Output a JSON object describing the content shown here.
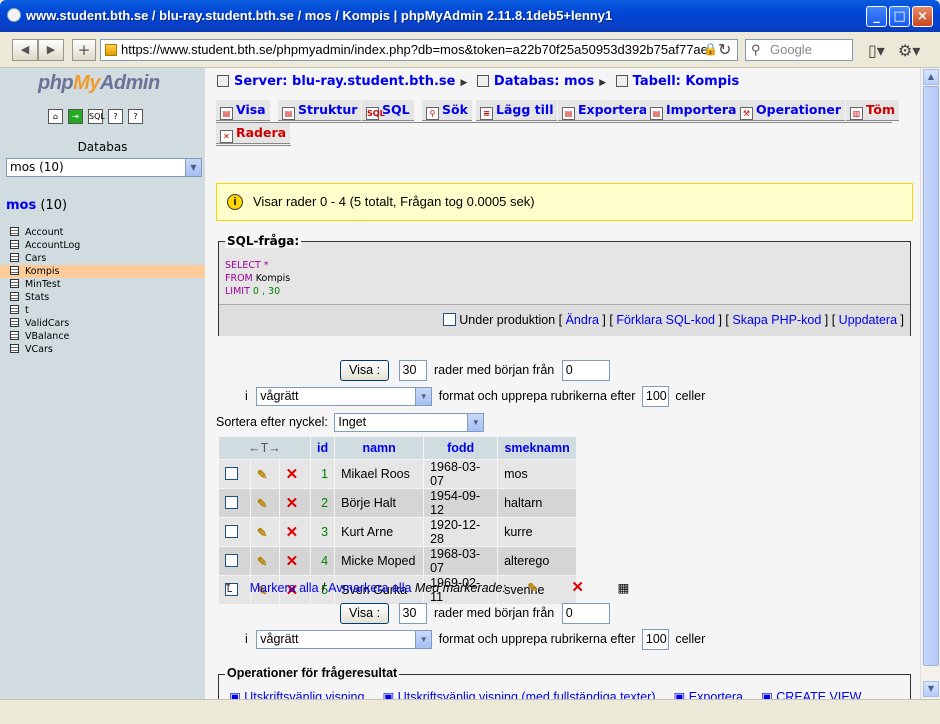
{
  "window": {
    "title": "www.student.bth.se / blu-ray.student.bth.se / mos / Kompis | phpMyAdmin 2.11.8.1deb5+lenny1"
  },
  "browser": {
    "url": "https://www.student.bth.se/phpmyadmin/index.php?db=mos&token=a22b70f25a50953d392b75af77ae",
    "search_placeholder": "Google"
  },
  "sidebar": {
    "logo": {
      "php": "php",
      "my": "My",
      "admin": "Admin"
    },
    "db_label": "Databas",
    "db_select": "mos (10)",
    "db_name": "mos",
    "db_count": "(10)",
    "tables": [
      "Account",
      "AccountLog",
      "Cars",
      "Kompis",
      "MinTest",
      "Stats",
      "t",
      "ValidCars",
      "VBalance",
      "VCars"
    ],
    "active_table": "Kompis"
  },
  "breadcrumb": {
    "server": "Server: blu-ray.student.bth.se",
    "database": "Databas: mos",
    "table": "Tabell: Kompis"
  },
  "tabs": [
    "Visa",
    "Struktur",
    "SQL",
    "Sök",
    "Lägg till",
    "Exportera",
    "Importera",
    "Operationer",
    "Töm",
    "Radera"
  ],
  "notice": "Visar rader 0 - 4 (5 totalt, Frågan tog 0.0005 sek)",
  "sql": {
    "legend": "SQL-fråga:",
    "select": "SELECT",
    "star": " *",
    "from": "FROM",
    "table": " Kompis",
    "limit": "LIMIT",
    "limit_vals": " 0 , 30"
  },
  "sql_links": {
    "production": "Under produktion",
    "edit": "Ändra",
    "explain": "Förklara SQL-kod",
    "php": "Skapa PHP-kod",
    "refresh": "Uppdatera"
  },
  "nav_top": {
    "show_button": "Visa :",
    "rows": "30",
    "rows_text": "rader med början från",
    "start": "0",
    "i_label": "i",
    "format": "vågrätt",
    "format_text": "format och upprepa rubrikerna efter",
    "repeat": "100",
    "cells": "celler"
  },
  "sort": {
    "label": "Sortera efter nyckel:",
    "value": "Inget"
  },
  "table": {
    "columns": [
      "id",
      "namn",
      "fodd",
      "smeknamn"
    ],
    "rows": [
      {
        "id": "1",
        "namn": "Mikael Roos",
        "fodd": "1968-03-07",
        "smeknamn": "mos"
      },
      {
        "id": "2",
        "namn": "Börje Halt",
        "fodd": "1954-09-12",
        "smeknamn": "haltarn"
      },
      {
        "id": "3",
        "namn": "Kurt Arne",
        "fodd": "1920-12-28",
        "smeknamn": "kurre"
      },
      {
        "id": "4",
        "namn": "Micke Moped",
        "fodd": "1968-03-07",
        "smeknamn": "alterego"
      },
      {
        "id": "5",
        "namn": "Sven Gurka",
        "fodd": "1969-02-11",
        "smeknamn": "svenne"
      }
    ]
  },
  "mark": {
    "all": "Markera alla",
    "sep": " / ",
    "none": "Avmarkera alla",
    "with": "Med markerade:"
  },
  "ops": {
    "legend": "Operationer för frågeresultat",
    "links": [
      "Utskriftsvänlig visning",
      "Utskriftsvänlig visning (med fullständiga texter)",
      "Exportera",
      "CREATE VIEW"
    ]
  }
}
